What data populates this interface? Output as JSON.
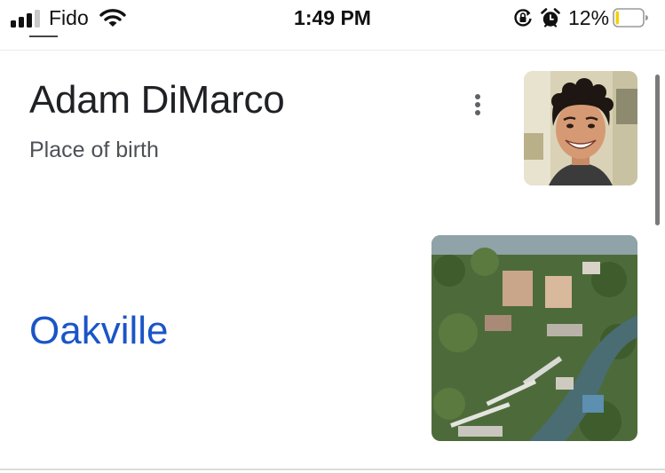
{
  "status_bar": {
    "carrier": "Fido",
    "time": "1:49 PM",
    "battery_percent": "12%",
    "signal_bars_filled": 3,
    "signal_bars_total": 4,
    "battery_level": 0.12,
    "icons": [
      "signal-icon",
      "wifi-icon",
      "rotation-lock-icon",
      "alarm-icon",
      "battery-icon"
    ]
  },
  "card": {
    "name": "Adam DiMarco",
    "subtitle": "Place of birth",
    "menu_icon": "more-vert-icon",
    "avatar_alt": "Adam DiMarco"
  },
  "result": {
    "place": "Oakville",
    "thumbnail_alt": "Oakville"
  },
  "colors": {
    "link": "#1a55c7",
    "title": "#202124",
    "subtitle": "#4d5156",
    "battery_low": "#f5d000"
  }
}
